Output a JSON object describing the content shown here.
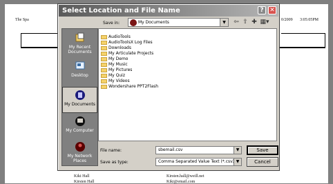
{
  "document": {
    "title": "The Spa",
    "date": "0/2009",
    "time": "3:05:05PM",
    "rows": [
      {
        "name": "Kiki Hall",
        "email": "Kirsten.hall@weill.net"
      },
      {
        "name": "Kirsten Hall",
        "email": "Kiki@email.com"
      }
    ]
  },
  "dialog": {
    "title": "Select Location and File Name",
    "save_in_label": "Save in:",
    "save_in_value": "My Documents",
    "places": [
      {
        "label": "My Recent Documents",
        "icon": "recent-documents-icon"
      },
      {
        "label": "Desktop",
        "icon": "desktop-icon"
      },
      {
        "label": "My Documents",
        "icon": "my-documents-icon"
      },
      {
        "label": "My Computer",
        "icon": "my-computer-icon"
      },
      {
        "label": "My Network Places",
        "icon": "network-places-icon"
      }
    ],
    "files": [
      "AudioTools",
      "AudioToolsX Log Files",
      "Downloads",
      "My Articulate Projects",
      "My Demo",
      "My Music",
      "My Pictures",
      "My Quiz",
      "My Videos",
      "Wondershare PPT2Flash"
    ],
    "file_name_label": "File name:",
    "file_name_value": "sbemail.csv",
    "save_type_label": "Save as type:",
    "save_type_value": "Comma Separated Value Text (*.csv)",
    "save_button": "Save",
    "cancel_button": "Cancel",
    "colors": {
      "title_bar": "#6a6a6a",
      "close_button": "#d9534f",
      "folder": "#f5d26a"
    }
  }
}
